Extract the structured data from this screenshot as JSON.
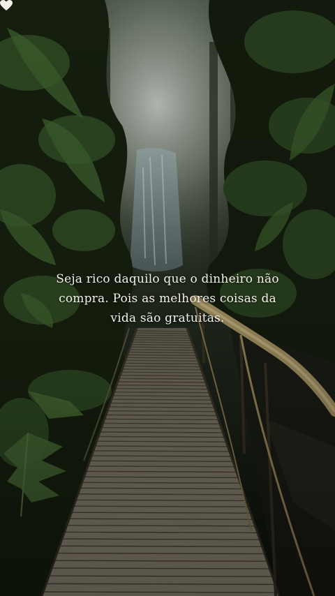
{
  "quote": {
    "lines": [
      "Seja rico daquilo que o dinheiro não",
      "compra. Pois as melhores coisas da",
      "vida são gratuitas."
    ]
  },
  "icons": {
    "heart": "heart-icon"
  },
  "colors": {
    "text": "#f4f1ea",
    "heart": "#f2efe9",
    "mist": "#c8ccc6",
    "foliage_dark": "#16200f",
    "foliage_green": "#2f4a22",
    "bridge_plank": "#8a8270",
    "handrail": "#b9a56e"
  }
}
